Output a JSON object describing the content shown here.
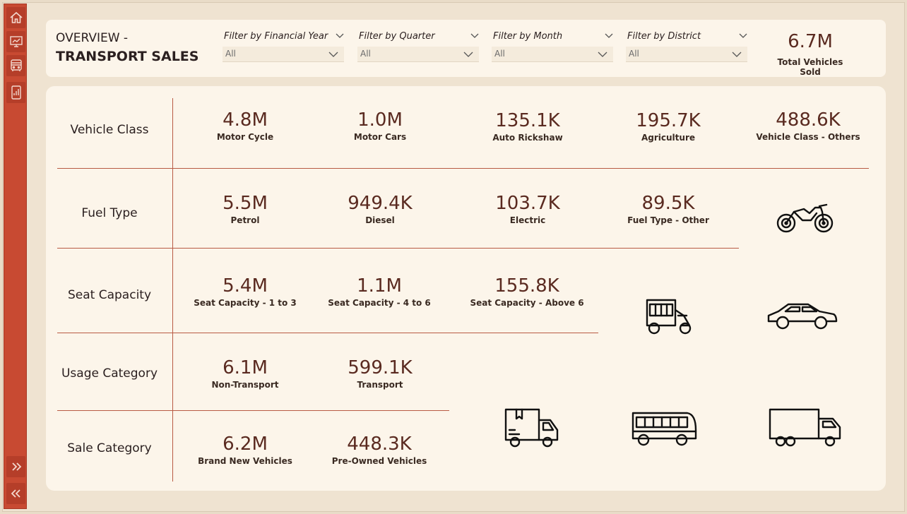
{
  "header": {
    "title_line1": "OVERVIEW -",
    "title_line2": "TRANSPORT SALES",
    "filters": [
      {
        "label": "Filter by Financial Year",
        "value": "All"
      },
      {
        "label": "Filter by Quarter",
        "value": "All"
      },
      {
        "label": "Filter by Month",
        "value": "All"
      },
      {
        "label": "Filter by District",
        "value": "All"
      }
    ],
    "total": {
      "value": "6.7M",
      "label": "Total Vehicles Sold"
    }
  },
  "sidebar": {
    "icons": [
      "home-icon",
      "monitor-report-icon",
      "bus-icon",
      "phone-chart-icon"
    ],
    "expand_icon": "double-chevron-right-icon",
    "collapse_icon": "double-chevron-left-icon"
  },
  "rows": {
    "vehicle_class": {
      "label": "Vehicle Class",
      "kpis": [
        {
          "value": "4.8M",
          "label": "Motor Cycle"
        },
        {
          "value": "1.0M",
          "label": "Motor Cars"
        },
        {
          "value": "135.1K",
          "label": "Auto Rickshaw"
        },
        {
          "value": "195.7K",
          "label": "Agriculture"
        },
        {
          "value": "488.6K",
          "label": "Vehicle Class - Others"
        }
      ]
    },
    "fuel_type": {
      "label": "Fuel Type",
      "kpis": [
        {
          "value": "5.5M",
          "label": "Petrol"
        },
        {
          "value": "949.4K",
          "label": "Diesel"
        },
        {
          "value": "103.7K",
          "label": "Electric"
        },
        {
          "value": "89.5K",
          "label": "Fuel Type - Other"
        }
      ]
    },
    "seat_capacity": {
      "label": "Seat Capacity",
      "kpis": [
        {
          "value": "5.4M",
          "label": "Seat Capacity - 1 to 3"
        },
        {
          "value": "1.1M",
          "label": "Seat Capacity - 4 to 6"
        },
        {
          "value": "155.8K",
          "label": "Seat Capacity - Above 6"
        }
      ]
    },
    "usage_category": {
      "label": "Usage Category",
      "kpis": [
        {
          "value": "6.1M",
          "label": "Non-Transport"
        },
        {
          "value": "599.1K",
          "label": "Transport"
        }
      ]
    },
    "sale_category": {
      "label": "Sale Category",
      "kpis": [
        {
          "value": "6.2M",
          "label": "Brand New Vehicles"
        },
        {
          "value": "448.3K",
          "label": "Pre-Owned Vehicles"
        }
      ]
    }
  },
  "vehicle_icons": [
    "motorcycle-icon",
    "auto-rickshaw-icon",
    "car-icon",
    "delivery-truck-icon",
    "bus-icon",
    "lorry-icon"
  ],
  "colors": {
    "accent": "#c84a32",
    "value_text": "#5a2a20",
    "divider": "#b85a44",
    "panel_bg": "#fcf5ea",
    "page_bg": "#efe3d1"
  }
}
